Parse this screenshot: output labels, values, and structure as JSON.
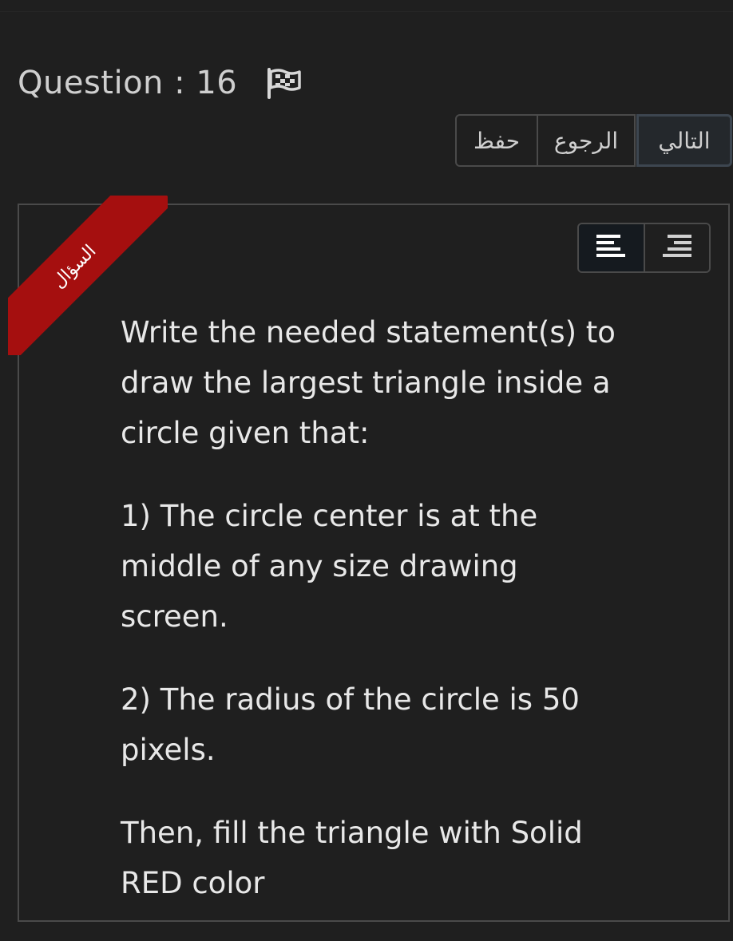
{
  "header": {
    "title": "Question : 16",
    "flag_icon": "flag-icon"
  },
  "nav": {
    "save_label": "حفظ",
    "back_label": "الرجوع",
    "next_label": "التالي"
  },
  "card": {
    "ribbon_label": "السؤال",
    "ribbon_color": "#a50f0f",
    "align_buttons": [
      {
        "icon": "align-left-icon",
        "active": true
      },
      {
        "icon": "align-right-icon",
        "active": false
      }
    ],
    "paragraphs": [
      "Write the needed statement(s) to draw the largest triangle inside a circle given that:",
      "1) The circle center is at the middle of any size drawing screen.",
      "2) The radius of the circle is 50 pixels.",
      "Then, fill the triangle with Solid RED color"
    ]
  }
}
